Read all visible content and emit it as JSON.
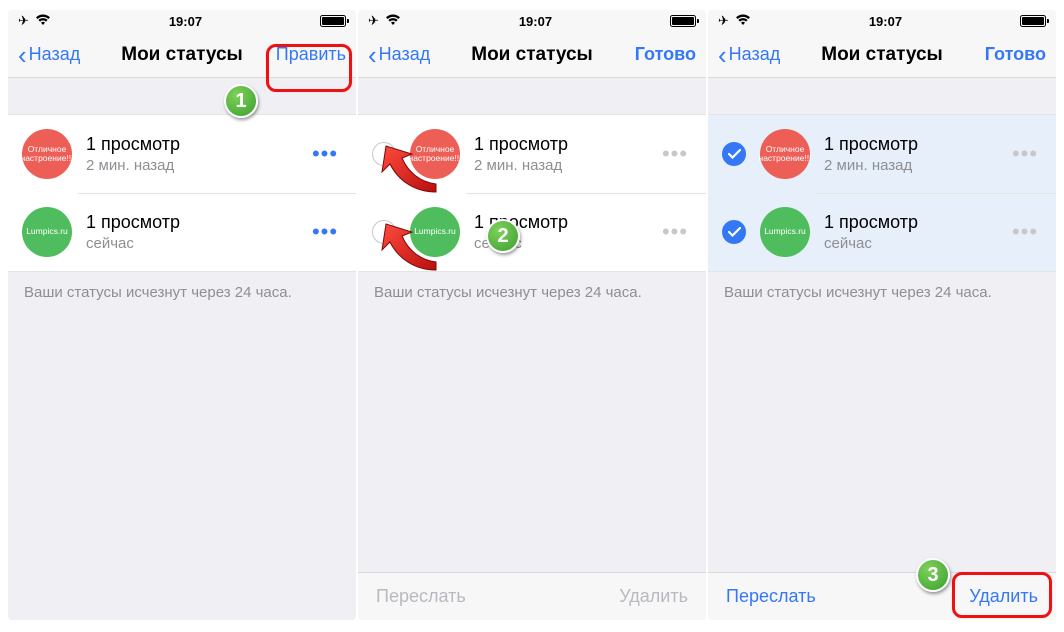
{
  "statusbar": {
    "time": "19:07"
  },
  "nav": {
    "back": "Назад",
    "title": "Мои статусы",
    "edit": "Править",
    "done": "Готово"
  },
  "avatars": {
    "pink_text": "Отличное настроение!!!",
    "green_text": "Lumpics.ru"
  },
  "rows": [
    {
      "title": "1 просмотр",
      "sub": "2 мин. назад"
    },
    {
      "title": "1 просмотр",
      "sub": "сейчас"
    }
  ],
  "footer_note": "Ваши статусы исчезнут через 24 часа.",
  "toolbar": {
    "forward": "Переслать",
    "delete": "Удалить"
  },
  "steps": {
    "1": "1",
    "2": "2",
    "3": "3"
  }
}
